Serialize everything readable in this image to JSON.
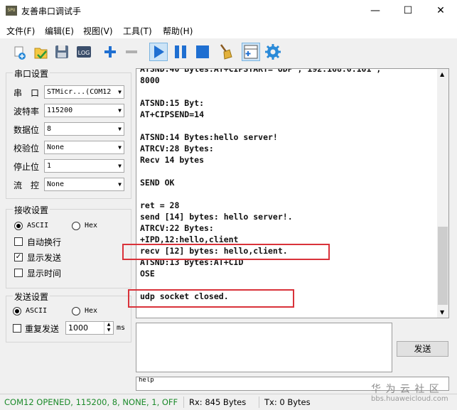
{
  "window": {
    "title": "友善串口调试手",
    "app_icon_text": "SPU",
    "minimize": "—",
    "maximize": "☐",
    "close": "✕"
  },
  "menu": [
    "文件(F)",
    "编辑(E)",
    "视图(V)",
    "工具(T)",
    "帮助(H)"
  ],
  "toolbar": {
    "icons": [
      "new-icon",
      "open-icon",
      "save-icon",
      "log-icon",
      "add-icon",
      "remove-icon",
      "play-icon",
      "pause-icon",
      "stop-icon",
      "clear-broom-icon",
      "panel-icon",
      "settings-gear-icon"
    ],
    "log_label": "LOG"
  },
  "serial_settings": {
    "title": "串口设置",
    "port_label": "串　口",
    "port_value": "STMicr...(COM12",
    "baud_label": "波特率",
    "baud_value": "115200",
    "databits_label": "数据位",
    "databits_value": "8",
    "parity_label": "校验位",
    "parity_value": "None",
    "stopbits_label": "停止位",
    "stopbits_value": "1",
    "flow_label": "流　控",
    "flow_value": "None"
  },
  "receive_settings": {
    "title": "接收设置",
    "ascii": "ASCII",
    "hex": "Hex",
    "auto_newline": "自动换行",
    "show_send": "显示发送",
    "show_time": "显示时间"
  },
  "send_settings": {
    "title": "发送设置",
    "ascii": "ASCII",
    "hex": "Hex",
    "repeat_label": "重复发送",
    "repeat_value": "1000",
    "unit": "ms"
  },
  "log_lines": [
    "ATSND:40 Bytes:AT+CIPSTART=\"UDP\",\"192.168.0.101\",",
    "8000",
    "",
    "ATSND:15 Byt:",
    "AT+CIPSEND=14",
    "",
    "ATSND:14 Bytes:hello server!",
    "ATRCV:28 Bytes:",
    "Recv 14 bytes",
    "",
    "SEND OK",
    "",
    "ret = 28",
    "send [14] bytes: hello server!.",
    "ATRCV:22 Bytes:",
    "+IPD,12:hello,client",
    "recv [12] bytes: hello,client.",
    "ATSND:13 Bytes:AT+CID",
    "OSE",
    "",
    "udp socket closed."
  ],
  "send_button": "发送",
  "cmd_input_value": "help",
  "status": {
    "connection": "COM12 OPENED, 115200, 8, NONE, 1, OFF",
    "rx": "Rx: 845 Bytes",
    "tx": "Tx: 0 Bytes"
  },
  "watermark": {
    "line1": "华 为 云 社 区",
    "line2": "bbs.huaweicloud.com"
  },
  "colors": {
    "highlight_box": "#d9323a",
    "status_text": "#1b8a2a",
    "toolbar_blue": "#1f6fd1"
  }
}
